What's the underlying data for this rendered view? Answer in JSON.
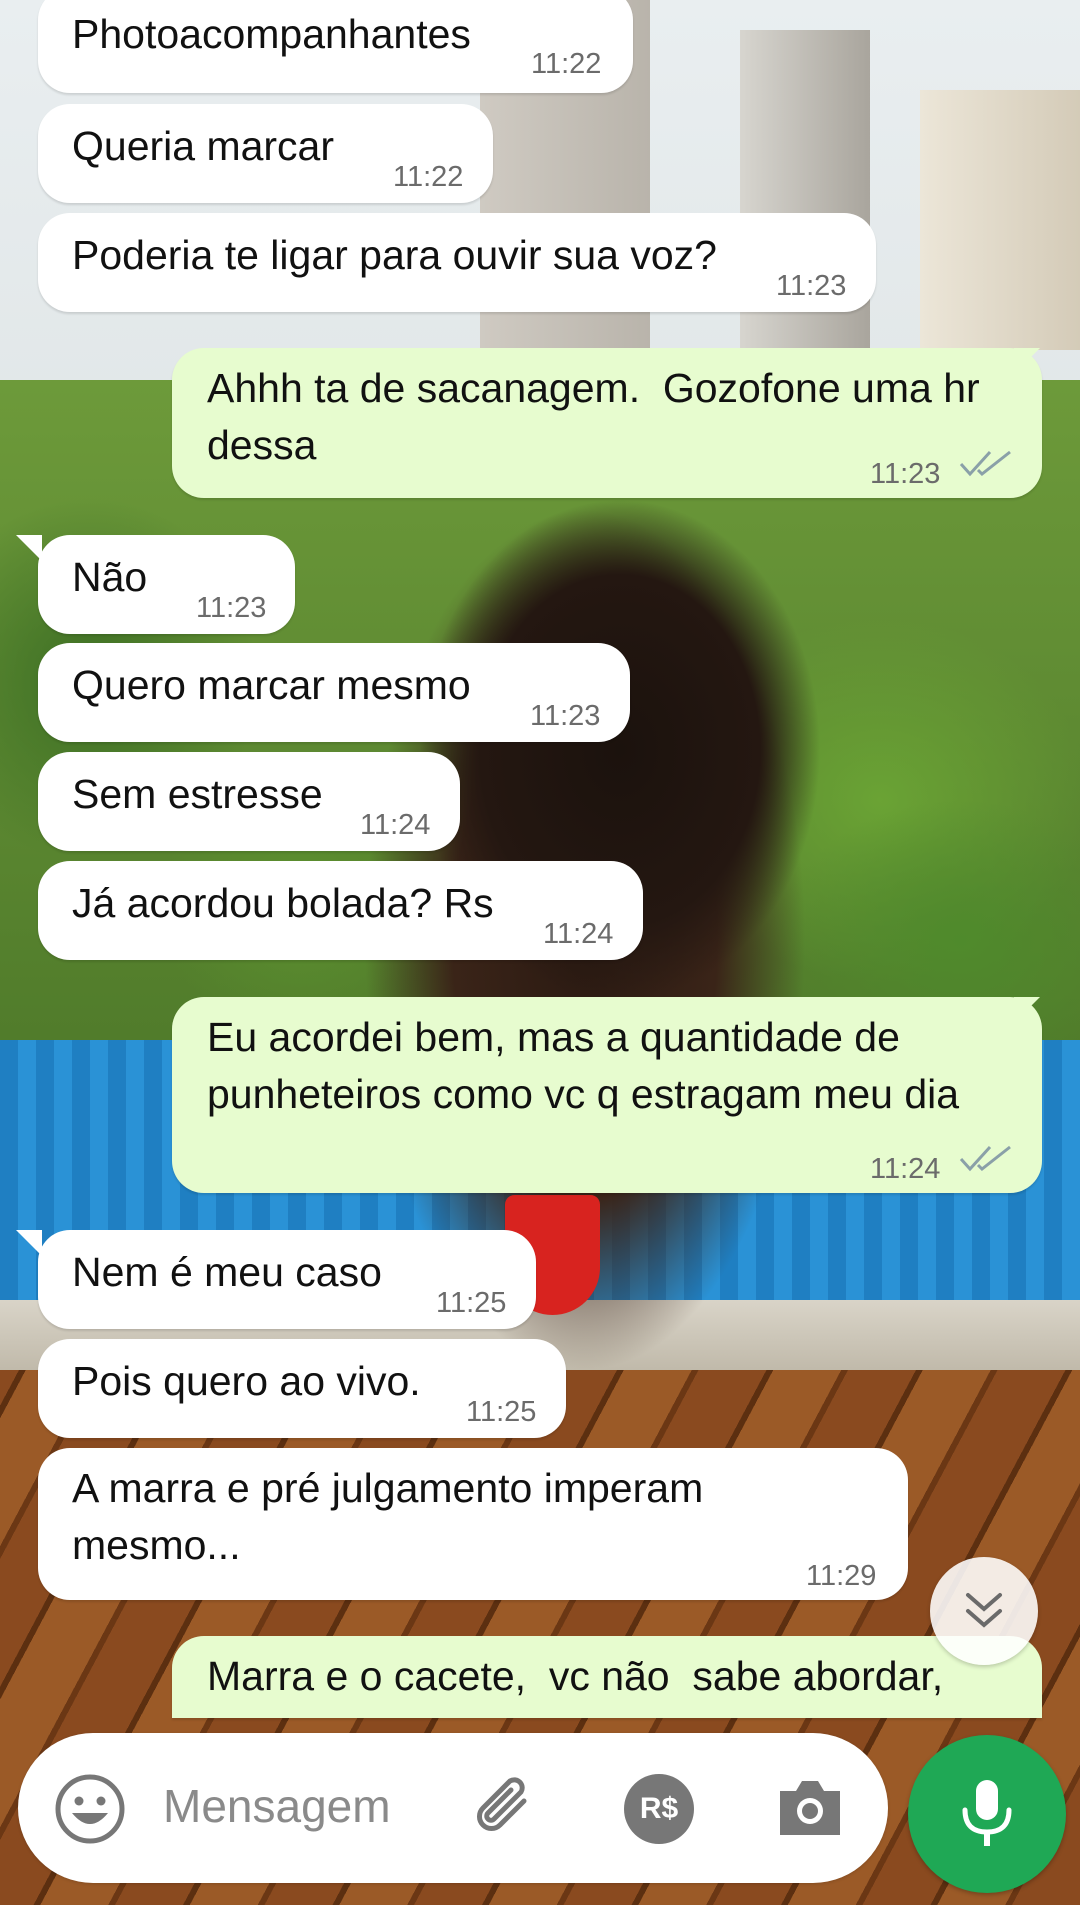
{
  "messages": [
    {
      "dir": "in",
      "lines": "Photoacompanhantes",
      "time": "11:22"
    },
    {
      "dir": "in",
      "lines": "Queria marcar",
      "time": "11:22"
    },
    {
      "dir": "in",
      "lines": "Poderia te ligar para ouvir sua voz?",
      "time": "11:23"
    },
    {
      "dir": "out",
      "lines": "Ahhh ta de sacanagem.  Gozofone uma hr\ndessa",
      "time": "11:23",
      "read": true
    },
    {
      "dir": "in",
      "lines": "Não",
      "time": "11:23"
    },
    {
      "dir": "in",
      "lines": "Quero marcar mesmo",
      "time": "11:23"
    },
    {
      "dir": "in",
      "lines": "Sem estresse",
      "time": "11:24"
    },
    {
      "dir": "in",
      "lines": "Já acordou bolada? Rs",
      "time": "11:24"
    },
    {
      "dir": "out",
      "lines": "Eu acordei bem, mas a quantidade de\npunheteiros como vc q estragam meu dia",
      "time": "11:24",
      "read": true
    },
    {
      "dir": "in",
      "lines": "Nem é meu caso",
      "time": "11:25"
    },
    {
      "dir": "in",
      "lines": "Pois quero ao vivo.",
      "time": "11:25"
    },
    {
      "dir": "in",
      "lines": "A marra e pré julgamento imperam\nmesmo...",
      "time": "11:29"
    },
    {
      "dir": "out",
      "lines": "Marra e o cacete,  vc não  sabe abordar,",
      "time": "",
      "read": false
    }
  ],
  "composer": {
    "placeholder": "Mensagem",
    "icons": [
      "emoji-icon",
      "attach-icon",
      "pix-icon",
      "camera-icon",
      "mic-icon"
    ],
    "pix_label": "R$"
  },
  "scroll_button": {
    "icon": "double-chevron-down-icon"
  },
  "colors": {
    "incoming": "#ffffff",
    "outgoing": "#e7fccf",
    "accent": "#1fa855",
    "read_ticks": "#8aa0a8"
  }
}
